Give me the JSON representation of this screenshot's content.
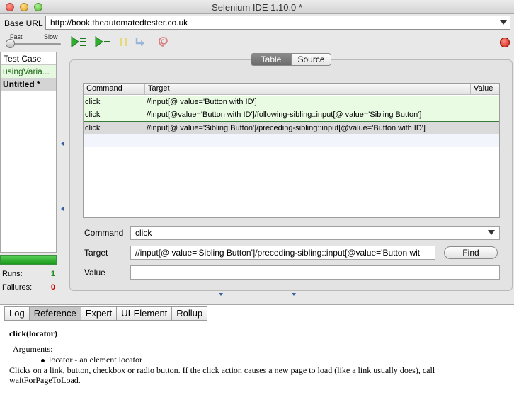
{
  "window": {
    "title": "Selenium IDE 1.10.0 *"
  },
  "base_url": {
    "label": "Base URL",
    "value": "http://book.theautomatedtester.co.uk"
  },
  "toolbar": {
    "speed_fast": "Fast",
    "speed_slow": "Slow",
    "speed_level": 0,
    "buttons": [
      "play-all-icon",
      "play-current-icon",
      "pause-icon",
      "step-icon",
      "rollup-icon",
      "record-icon"
    ]
  },
  "test_cases": {
    "header": "Test Case",
    "items": [
      {
        "label": "usingVaria...",
        "status": "passed"
      },
      {
        "label": "Untitled *",
        "status": "current"
      }
    ]
  },
  "stats": {
    "runs_label": "Runs:",
    "runs_value": "1",
    "failures_label": "Failures:",
    "failures_value": "0",
    "progress": 1.0
  },
  "view_tabs": [
    "Table",
    "Source"
  ],
  "active_view_tab": "Table",
  "command_table": {
    "headers": [
      "Command",
      "Target",
      "Value"
    ],
    "rows": [
      {
        "command": "click",
        "target": "//input[@ value='Button with ID']",
        "value": "",
        "state": "passed"
      },
      {
        "command": "click",
        "target": "//input[@value='Button with ID']/following-sibling::input[@ value='Sibling Button']",
        "value": "",
        "state": "passed"
      },
      {
        "command": "click",
        "target": "//input[@ value='Sibling Button']/preceding-sibling::input[@value='Button with ID']",
        "value": "",
        "state": "selected"
      }
    ]
  },
  "editor": {
    "command_label": "Command",
    "command_value": "click",
    "target_label": "Target",
    "target_value": "//input[@ value='Sibling Button']/preceding-sibling::input[@value='Button wit",
    "find_label": "Find",
    "value_label": "Value",
    "value_value": ""
  },
  "bottom_tabs": [
    "Log",
    "Reference",
    "Expert",
    "UI-Element",
    "Rollup"
  ],
  "active_bottom_tab": "Reference",
  "reference": {
    "title": "click(locator)",
    "arguments_label": "Arguments:",
    "argument": "locator - an element locator",
    "description": "Clicks on a link, button, checkbox or radio button. If the click action causes a new page to load (like a link usually does), call waitForPageToLoad."
  },
  "colors": {
    "passed_row": "#eafbe4",
    "selected_row": "#dadada",
    "progress_green": "#1a9a1a",
    "record_red": "#d01c10",
    "failures_red": "#cc0000",
    "runs_green": "#1a8a1a"
  }
}
